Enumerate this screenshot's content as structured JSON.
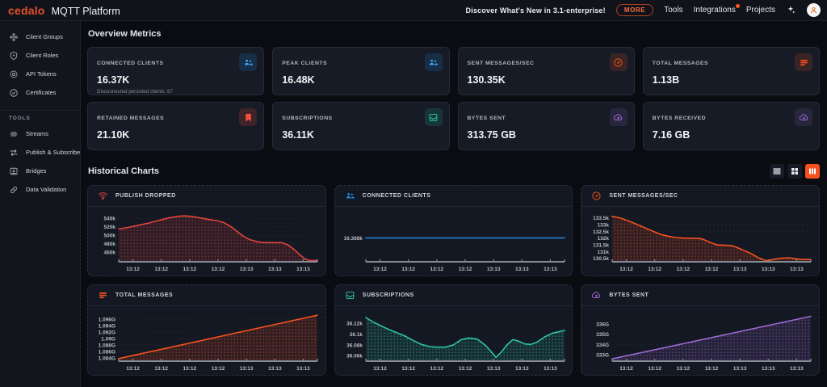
{
  "navbar": {
    "logo": "cedalo",
    "title": "MQTT Platform",
    "announcement": "Discover What's New in 3.1-enterprise!",
    "more_label": "MORE",
    "links": [
      "Tools",
      "Integrations",
      "Projects"
    ],
    "integrations_has_notification": true,
    "icons": {
      "sparkles": "sparkles-icon",
      "avatar": "avatar-icon"
    },
    "accent_color": "#e8502a"
  },
  "sidebar": {
    "items": [
      {
        "label": "Client Groups",
        "icon": "client-groups-icon"
      },
      {
        "label": "Client Roles",
        "icon": "shield-icon"
      },
      {
        "label": "API Tokens",
        "icon": "token-icon"
      },
      {
        "label": "Certificates",
        "icon": "certificate-icon"
      }
    ],
    "section_label": "TOOLS",
    "tools": [
      {
        "label": "Streams",
        "icon": "streams-icon"
      },
      {
        "label": "Publish & Subscribe",
        "icon": "publish-subscribe-icon"
      },
      {
        "label": "Bridges",
        "icon": "bridge-icon"
      },
      {
        "label": "Data Validation",
        "icon": "link-icon"
      }
    ]
  },
  "overview": {
    "heading": "Overview Metrics",
    "cards": [
      {
        "label": "CONNECTED CLIENTS",
        "value": "16.37K",
        "sub": "Disconnected persisted clients: 87",
        "icon": "people-icon",
        "color": "#42a5f5"
      },
      {
        "label": "PEAK CLIENTS",
        "value": "16.48K",
        "sub": "",
        "icon": "people-icon",
        "color": "#42a5f5"
      },
      {
        "label": "SENT MESSAGES/SEC",
        "value": "130.35K",
        "sub": "",
        "icon": "gauge-icon",
        "color": "#f4511e"
      },
      {
        "label": "TOTAL MESSAGES",
        "value": "1.13B",
        "sub": "",
        "icon": "message-lines-icon",
        "color": "#f4511e"
      },
      {
        "label": "RETAINED MESSAGES",
        "value": "21.10K",
        "sub": "",
        "icon": "bookmark-icon",
        "color": "#f4503a"
      },
      {
        "label": "SUBSCRIPTIONS",
        "value": "36.11K",
        "sub": "",
        "icon": "inbox-icon",
        "color": "#26c6a2"
      },
      {
        "label": "BYTES SENT",
        "value": "313.75 GB",
        "sub": "",
        "icon": "cloud-up-icon",
        "color": "#9b6bd3"
      },
      {
        "label": "BYTES RECEIVED",
        "value": "7.16 GB",
        "sub": "",
        "icon": "cloud-down-icon",
        "color": "#9b6bd3"
      }
    ]
  },
  "charts_section": {
    "heading": "Historical Charts",
    "view_toggles": [
      {
        "name": "list-view",
        "icon": "list-view-icon",
        "active": false
      },
      {
        "name": "grid-view",
        "icon": "grid-view-icon",
        "active": false
      },
      {
        "name": "column-view",
        "icon": "column-view-icon",
        "active": true
      }
    ],
    "active_toggle_color": "#f4511e"
  },
  "chart_data": [
    {
      "type": "area",
      "title": "PUBLISH DROPPED",
      "icon": "wifi-dropped-icon",
      "color": "#e0443a",
      "fill": true,
      "grid": true,
      "x_labels": [
        "13:12",
        "13:12",
        "13:12",
        "13:12",
        "13:13",
        "13:13",
        "13:13"
      ],
      "ylabel_unit": "k",
      "y_ticks": [
        {
          "label": "540k",
          "value": 540
        },
        {
          "label": "520k",
          "value": 520
        },
        {
          "label": "500k",
          "value": 500
        },
        {
          "label": "480k",
          "value": 480
        },
        {
          "label": "460k",
          "value": 460
        }
      ],
      "ylim": [
        438,
        552
      ],
      "points": [
        [
          0,
          515
        ],
        [
          0.05,
          519
        ],
        [
          0.1,
          524
        ],
        [
          0.15,
          529
        ],
        [
          0.2,
          535
        ],
        [
          0.25,
          541
        ],
        [
          0.3,
          545
        ],
        [
          0.33,
          546
        ],
        [
          0.36,
          545
        ],
        [
          0.4,
          542
        ],
        [
          0.45,
          538
        ],
        [
          0.5,
          534
        ],
        [
          0.53,
          530
        ],
        [
          0.56,
          522
        ],
        [
          0.6,
          508
        ],
        [
          0.63,
          497
        ],
        [
          0.66,
          490
        ],
        [
          0.7,
          485
        ],
        [
          0.74,
          483
        ],
        [
          0.78,
          483
        ],
        [
          0.82,
          483
        ],
        [
          0.85,
          478
        ],
        [
          0.88,
          468
        ],
        [
          0.91,
          455
        ],
        [
          0.94,
          444
        ],
        [
          0.96,
          441
        ],
        [
          1,
          441
        ]
      ]
    },
    {
      "type": "line",
      "title": "CONNECTED CLIENTS",
      "icon": "people-icon",
      "color": "#1e88e5",
      "fill": false,
      "grid": false,
      "x_labels": [
        "13:12",
        "13:12",
        "13:12",
        "13:12",
        "13:13",
        "13:13",
        "13:13"
      ],
      "ylabel_unit": "k",
      "y_ticks": [
        {
          "label": "16.368k",
          "value": 16.368
        }
      ],
      "ylim": [
        16.26,
        16.48
      ],
      "points": [
        [
          0,
          16.368
        ],
        [
          1,
          16.368
        ]
      ]
    },
    {
      "type": "area",
      "title": "SENT MESSAGES/SEC",
      "icon": "gauge-icon",
      "color": "#f4511e",
      "fill": true,
      "grid": true,
      "x_labels": [
        "13:12",
        "13:12",
        "13:12",
        "13:12",
        "13:13",
        "13:13",
        "13:13"
      ],
      "ylabel_unit": "k",
      "y_ticks": [
        {
          "label": "133.5k",
          "value": 133.5
        },
        {
          "label": "133k",
          "value": 133
        },
        {
          "label": "132.5k",
          "value": 132.5
        },
        {
          "label": "132k",
          "value": 132
        },
        {
          "label": "131.5k",
          "value": 131.5
        },
        {
          "label": "131k",
          "value": 131
        },
        {
          "label": "130.5k",
          "value": 130.5
        }
      ],
      "ylim": [
        130.25,
        133.85
      ],
      "points": [
        [
          0,
          133.62
        ],
        [
          0.04,
          133.5
        ],
        [
          0.08,
          133.3
        ],
        [
          0.12,
          133.05
        ],
        [
          0.16,
          132.8
        ],
        [
          0.2,
          132.55
        ],
        [
          0.24,
          132.3
        ],
        [
          0.28,
          132.15
        ],
        [
          0.32,
          132.05
        ],
        [
          0.36,
          132.0
        ],
        [
          0.4,
          132.0
        ],
        [
          0.44,
          131.98
        ],
        [
          0.46,
          131.9
        ],
        [
          0.5,
          131.65
        ],
        [
          0.53,
          131.5
        ],
        [
          0.57,
          131.48
        ],
        [
          0.6,
          131.45
        ],
        [
          0.63,
          131.3
        ],
        [
          0.67,
          131.05
        ],
        [
          0.7,
          130.85
        ],
        [
          0.73,
          130.6
        ],
        [
          0.76,
          130.4
        ],
        [
          0.78,
          130.32
        ],
        [
          0.81,
          130.42
        ],
        [
          0.85,
          130.52
        ],
        [
          0.89,
          130.55
        ],
        [
          0.92,
          130.48
        ],
        [
          0.95,
          130.42
        ],
        [
          1,
          130.42
        ]
      ]
    },
    {
      "type": "area",
      "title": "TOTAL MESSAGES",
      "icon": "message-lines-icon",
      "color": "#f4511e",
      "fill": true,
      "grid": true,
      "x_labels": [
        "13:12",
        "13:12",
        "13:12",
        "13:12",
        "13:13",
        "13:13",
        "13:13"
      ],
      "ylabel_unit": "G",
      "y_ticks": [
        {
          "label": "1.096G",
          "value": 1.096
        },
        {
          "label": "1.094G",
          "value": 1.094
        },
        {
          "label": "1.092G",
          "value": 1.092
        },
        {
          "label": "1.09G",
          "value": 1.09
        },
        {
          "label": "1.088G",
          "value": 1.088
        },
        {
          "label": "1.086G",
          "value": 1.086
        },
        {
          "label": "1.084G",
          "value": 1.084
        }
      ],
      "ylim": [
        1.083,
        1.098
      ],
      "points": [
        [
          0,
          1.0838
        ],
        [
          1,
          1.0972
        ]
      ]
    },
    {
      "type": "area",
      "title": "SUBSCRIPTIONS",
      "icon": "inbox-icon",
      "color": "#2ec5a5",
      "fill": true,
      "grid": true,
      "x_labels": [
        "13:12",
        "13:12",
        "13:12",
        "13:12",
        "13:13",
        "13:13",
        "13:13"
      ],
      "ylabel_unit": "k",
      "y_ticks": [
        {
          "label": "36.12k",
          "value": 36.12
        },
        {
          "label": "36.1k",
          "value": 36.1
        },
        {
          "label": "36.08k",
          "value": 36.08
        },
        {
          "label": "36.06k",
          "value": 36.06
        }
      ],
      "ylim": [
        36.05,
        36.14
      ],
      "points": [
        [
          0,
          36.131
        ],
        [
          0.04,
          36.122
        ],
        [
          0.08,
          36.115
        ],
        [
          0.12,
          36.108
        ],
        [
          0.16,
          36.102
        ],
        [
          0.2,
          36.096
        ],
        [
          0.24,
          36.088
        ],
        [
          0.28,
          36.081
        ],
        [
          0.32,
          36.077
        ],
        [
          0.36,
          36.076
        ],
        [
          0.4,
          36.076
        ],
        [
          0.44,
          36.08
        ],
        [
          0.48,
          36.09
        ],
        [
          0.52,
          36.093
        ],
        [
          0.56,
          36.091
        ],
        [
          0.6,
          36.08
        ],
        [
          0.63,
          36.068
        ],
        [
          0.655,
          36.057
        ],
        [
          0.68,
          36.066
        ],
        [
          0.71,
          36.08
        ],
        [
          0.74,
          36.09
        ],
        [
          0.77,
          36.087
        ],
        [
          0.8,
          36.082
        ],
        [
          0.83,
          36.081
        ],
        [
          0.86,
          36.085
        ],
        [
          0.9,
          36.095
        ],
        [
          0.94,
          36.102
        ],
        [
          1,
          36.107
        ]
      ]
    },
    {
      "type": "area",
      "title": "BYTES SENT",
      "icon": "cloud-up-icon",
      "color": "#9b6bd3",
      "fill": true,
      "grid": true,
      "x_labels": [
        "13:12",
        "13:12",
        "13:12",
        "13:12",
        "13:13",
        "13:13",
        "13:13"
      ],
      "ylabel_unit": "G",
      "y_ticks": [
        {
          "label": "336G",
          "value": 336
        },
        {
          "label": "335G",
          "value": 335
        },
        {
          "label": "334G",
          "value": 334
        },
        {
          "label": "333G",
          "value": 333
        }
      ],
      "ylim": [
        332.4,
        337.1
      ],
      "points": [
        [
          0,
          332.62
        ],
        [
          1,
          336.75
        ]
      ]
    }
  ]
}
